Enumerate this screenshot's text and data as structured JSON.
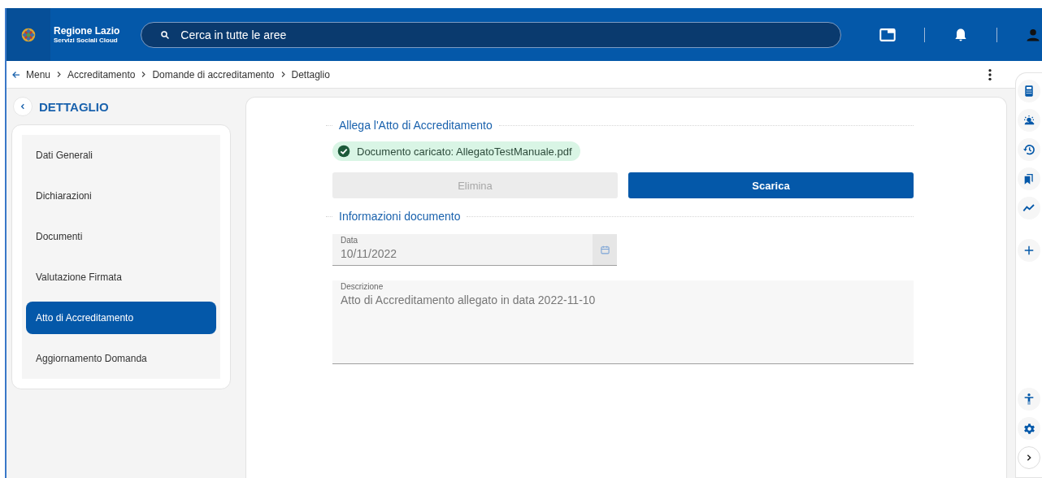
{
  "header": {
    "brand_title": "Regione Lazio",
    "brand_subtitle": "Servizi Sociali Cloud",
    "search": {
      "placeholder": "Cerca in tutte le aree"
    }
  },
  "breadcrumb": [
    "Menu",
    "Accreditamento",
    "Domande di accreditamento",
    "Dettaglio"
  ],
  "sidebar": {
    "title": "DETTAGLIO",
    "items": [
      {
        "label": "Dati Generali",
        "selected": false
      },
      {
        "label": "Dichiarazioni",
        "selected": false
      },
      {
        "label": "Documenti",
        "selected": false
      },
      {
        "label": "Valutazione Firmata",
        "selected": false
      },
      {
        "label": "Atto di Accreditamento",
        "selected": true
      },
      {
        "label": "Aggiornamento Domanda",
        "selected": false
      }
    ]
  },
  "attachment": {
    "title": "Allega l'Atto di Accreditamento",
    "status": "Documento caricato: AllegatoTestManuale.pdf",
    "buttons": [
      {
        "label": "Elimina",
        "disabled": true
      },
      {
        "label": "Scarica",
        "disabled": false
      }
    ]
  },
  "document_info": {
    "title": "Informazioni documento",
    "fields": [
      {
        "kind": "date",
        "label": "Data",
        "value": "10/11/2022",
        "disabled": true
      },
      {
        "kind": "textarea",
        "label": "Descrizione",
        "value": "Atto di Accreditamento allegato in data 2022-11-10",
        "disabled": true
      }
    ]
  }
}
